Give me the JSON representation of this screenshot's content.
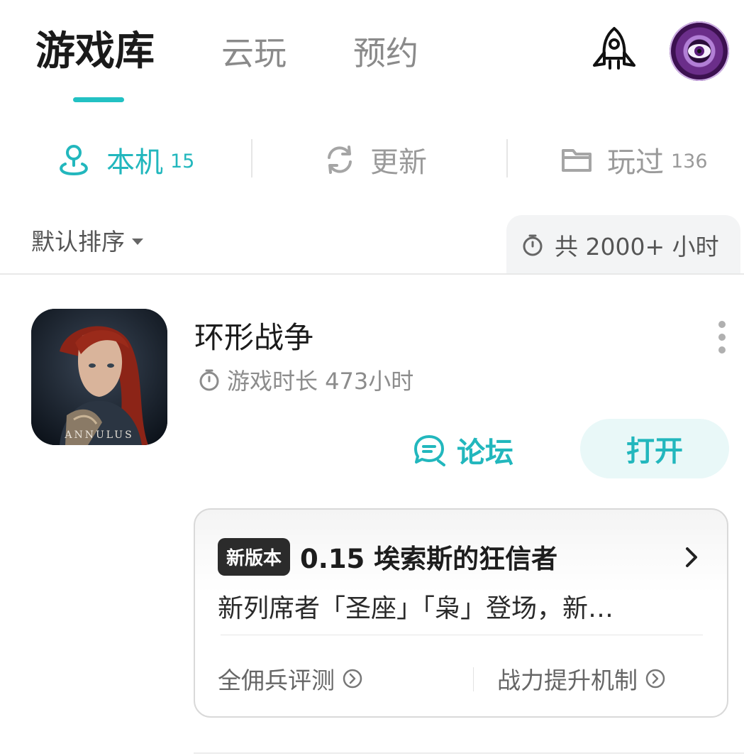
{
  "header": {
    "tabs": [
      {
        "label": "游戏库"
      },
      {
        "label": "云玩"
      },
      {
        "label": "预约"
      }
    ],
    "icons": {
      "rocket": "rocket-icon",
      "avatar": "avatar"
    }
  },
  "segments": [
    {
      "label": "本机",
      "count": "15",
      "icon": "location-pin-icon"
    },
    {
      "label": "更新",
      "count": "",
      "icon": "refresh-icon"
    },
    {
      "label": "玩过",
      "count": "136",
      "icon": "folder-icon"
    }
  ],
  "sort": {
    "label": "默认排序"
  },
  "total": {
    "label": "共 2000+ 小时"
  },
  "game": {
    "title": "环形战争",
    "playtime": "游戏时长 473小时",
    "cover_text": "ANNULUS",
    "forum_label": "论坛",
    "open_label": "打开"
  },
  "news": {
    "badge": "新版本",
    "title": "0.15 埃索斯的狂信者",
    "description": "新列席者「圣座」「枭」登场，新…",
    "links": [
      {
        "label": "全佣兵评测"
      },
      {
        "label": "战力提升机制"
      }
    ]
  },
  "colors": {
    "accent": "#22b7bd",
    "muted": "#9a9a9a"
  }
}
